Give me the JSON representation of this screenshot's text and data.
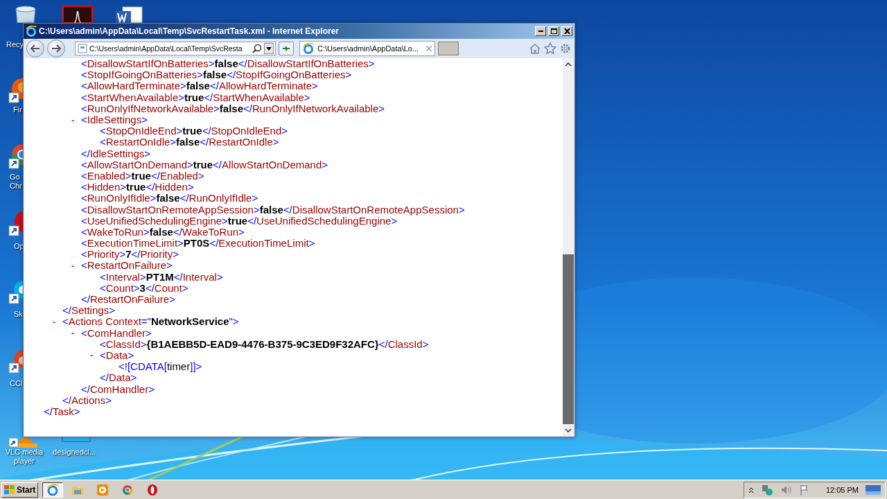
{
  "desktop_icons": [
    {
      "kind": "recycle-bin",
      "label": "Recy"
    },
    {
      "kind": "pdf"
    },
    {
      "kind": "word"
    },
    {
      "kind": "firefox",
      "label": "Fir"
    },
    {
      "kind": "chrome",
      "label": "Go\nChr"
    },
    {
      "kind": "opera",
      "label": "Op"
    },
    {
      "kind": "skype",
      "label": "Sk"
    },
    {
      "kind": "ccleaner",
      "label": "CCl"
    },
    {
      "kind": "vlc",
      "label": "VLC media player"
    },
    {
      "kind": "file",
      "label": "designedcl..."
    }
  ],
  "window": {
    "title": "C:\\Users\\admin\\AppData\\Local\\Temp\\SvcRestartTask.xml - Internet Explorer",
    "address": "C:\\Users\\admin\\AppData\\Local\\Temp\\SvcResta",
    "tabs": [
      {
        "label": "C:\\Users\\admin\\AppData\\Lo...",
        "selected": true
      }
    ]
  },
  "syntax": {
    "lt": "<",
    "gt": ">",
    "close": "</",
    "cdata_open": "<![CDATA[",
    "cdata_close": "]]>",
    "eq": "=",
    "quote": "\""
  },
  "document": {
    "kind": "tail",
    "end_tag": "Task",
    "children": [
      {
        "kind": "tail",
        "end_tag": "Settings",
        "children": [
          {
            "kind": "leaf",
            "tag": "DisallowStartIfOnBatteries",
            "value": "false",
            "end_tag": "DisallowStartIfOnBatteries"
          },
          {
            "kind": "leaf",
            "tag": "StopIfGoingOnBatteries",
            "value": "false",
            "end_tag": "StopIfGoingOnBatteries"
          },
          {
            "kind": "leaf",
            "tag": "AllowHardTerminate",
            "value": "false",
            "end_tag": "AllowHardTerminate"
          },
          {
            "kind": "leaf",
            "tag": "StartWhenAvailable",
            "value": "true",
            "end_tag": "StartWhenAvailable"
          },
          {
            "kind": "leaf",
            "tag": "RunOnlyIfNetworkAvailable",
            "value": "false",
            "end_tag": "RunOnlyIfNetworkAvailable"
          },
          {
            "kind": "element",
            "tag": "IdleSettings",
            "toggle": "-",
            "end_tag": "IdleSettings",
            "children": [
              {
                "kind": "leaf",
                "tag": "StopOnIdleEnd",
                "value": "true",
                "end_tag": "StopOnIdleEnd"
              },
              {
                "kind": "leaf",
                "tag": "RestartOnIdle",
                "value": "false",
                "end_tag": "RestartOnIdle"
              }
            ]
          },
          {
            "kind": "leaf",
            "tag": "AllowStartOnDemand",
            "value": "true",
            "end_tag": "AllowStartOnDemand"
          },
          {
            "kind": "leaf",
            "tag": "Enabled",
            "value": "true",
            "end_tag": "Enabled"
          },
          {
            "kind": "leaf",
            "tag": "Hidden",
            "value": "true",
            "end_tag": "Hidden"
          },
          {
            "kind": "leaf",
            "tag": "RunOnlyIfIdle",
            "value": "false",
            "end_tag": "RunOnlyIfIdle"
          },
          {
            "kind": "leaf",
            "tag": "DisallowStartOnRemoteAppSession",
            "value": "false",
            "end_tag": "DisallowStartOnRemoteAppSession"
          },
          {
            "kind": "leaf",
            "tag": "UseUnifiedSchedulingEngine",
            "value": "true",
            "end_tag": "UseUnifiedSchedulingEngine"
          },
          {
            "kind": "leaf",
            "tag": "WakeToRun",
            "value": "false",
            "end_tag": "WakeToRun"
          },
          {
            "kind": "leaf",
            "tag": "ExecutionTimeLimit",
            "value": "PT0S",
            "end_tag": "ExecutionTimeLimit"
          },
          {
            "kind": "leaf",
            "tag": "Priority",
            "value": "7",
            "end_tag": "Priority"
          },
          {
            "kind": "element",
            "tag": "RestartOnFailure",
            "toggle": "-",
            "end_tag": "RestartOnFailure",
            "children": [
              {
                "kind": "leaf",
                "tag": "Interval",
                "value": "PT1M",
                "end_tag": "Interval"
              },
              {
                "kind": "leaf",
                "tag": "Count",
                "value": "3",
                "end_tag": "Count"
              }
            ]
          }
        ]
      },
      {
        "kind": "element",
        "tag": "Actions",
        "toggle": "-",
        "attributes": [
          {
            "name": "Context",
            "value": "NetworkService"
          }
        ],
        "end_tag": "Actions",
        "children": [
          {
            "kind": "element",
            "tag": "ComHandler",
            "toggle": "-",
            "end_tag": "ComHandler",
            "children": [
              {
                "kind": "leaf",
                "tag": "ClassId",
                "value": "{B1AEBB5D-EAD9-4476-B375-9C3ED9F32AFC}",
                "end_tag": "ClassId"
              },
              {
                "kind": "element",
                "tag": "Data",
                "toggle": "-",
                "end_tag": "Data",
                "children": [
                  {
                    "kind": "cdata",
                    "value": "timer"
                  }
                ]
              }
            ]
          }
        ]
      }
    ]
  },
  "taskbar": {
    "start": "Start",
    "apps": [
      {
        "kind": "ie",
        "selected": true
      },
      {
        "kind": "folder",
        "selected": false
      },
      {
        "kind": "media",
        "selected": false
      },
      {
        "kind": "chrome",
        "selected": false
      },
      {
        "kind": "opera",
        "selected": false
      }
    ],
    "clock": "12:05 PM"
  }
}
